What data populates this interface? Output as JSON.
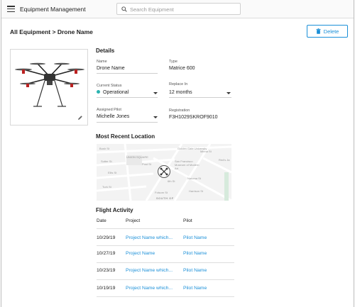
{
  "header": {
    "title": "Equipment Management",
    "search_placeholder": "Search Equipment"
  },
  "breadcrumb": "All Equipment > Drone Name",
  "actions": {
    "delete_label": "Delete"
  },
  "details": {
    "section_title": "Details",
    "name": {
      "label": "Name",
      "value": "Drone Name"
    },
    "type": {
      "label": "Type",
      "value": "Matrice 600"
    },
    "status": {
      "label": "Current Status",
      "value": "Operational",
      "color": "#2bb3b0"
    },
    "replace_in": {
      "label": "Replace In",
      "value": "12 months"
    },
    "pilot": {
      "label": "Assigned Pilot",
      "value": "Michelle Jones"
    },
    "registration": {
      "label": "Registration",
      "value": "F3H1029SKROF9010"
    }
  },
  "location": {
    "section_title": "Most Recent Location",
    "map_labels": [
      "Bush St",
      "Sutter St",
      "Golden Gate University",
      "UNION SQUARE",
      "Post St",
      "Minna St",
      "Ellis St",
      "San Francisco Museum of Modern Art",
      "Red's Ja",
      "Natoma St",
      "Turk St",
      "6th St",
      "Harrison St",
      "Folsom St",
      "SOUTH OF"
    ]
  },
  "flights": {
    "section_title": "Flight Activity",
    "columns": [
      "Date",
      "Project",
      "Pilot"
    ],
    "rows": [
      {
        "date": "10/29/19",
        "project": "Project Name which...",
        "pilot": "Pilot Name"
      },
      {
        "date": "10/27/19",
        "project": "Project Name",
        "pilot": "Pilot Name"
      },
      {
        "date": "10/23/19",
        "project": "Project Name which...",
        "pilot": "Pilot Name"
      },
      {
        "date": "10/19/19",
        "project": "Project Name which...",
        "pilot": "Pilot Name"
      }
    ]
  },
  "colors": {
    "accent": "#1a8fd8",
    "status_ok": "#2bb3b0"
  }
}
